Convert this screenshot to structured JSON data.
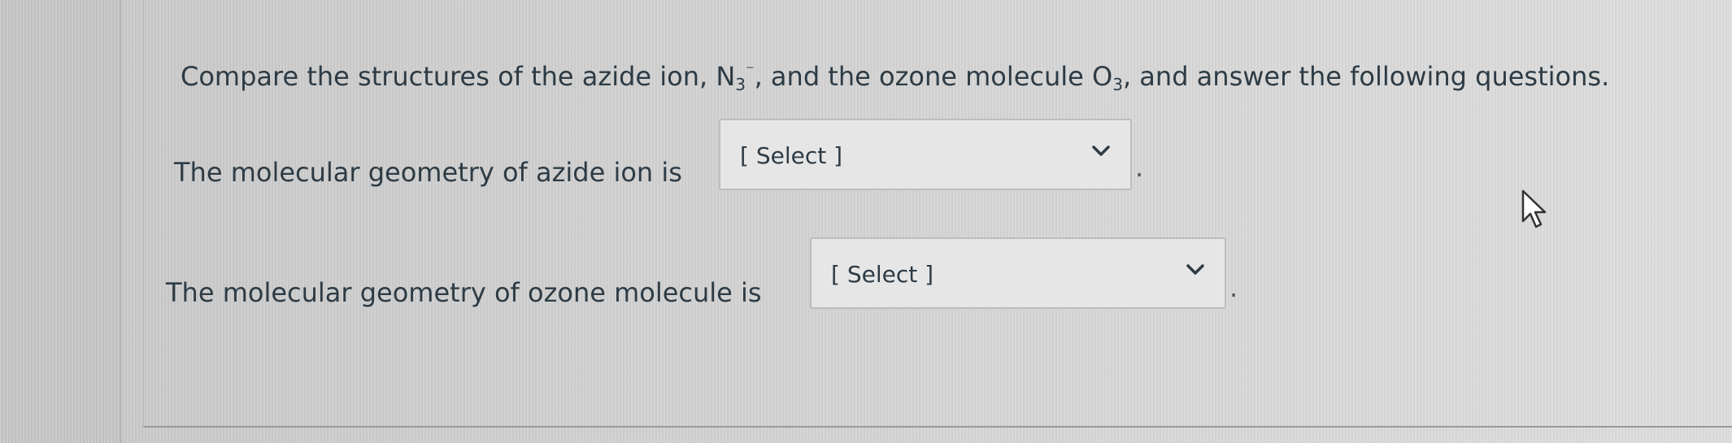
{
  "question": {
    "intro_before_n3": "Compare the structures of the azide ion, N",
    "n3_subscript": "3",
    "n3_superscript": "⁻",
    "intro_middle": ", and the ozone molecule O",
    "o3_subscript": "3",
    "intro_end": ", and answer the following questions."
  },
  "rows": [
    {
      "label": "The molecular geometry of azide ion is",
      "select_value": "[ Select ]",
      "after": "."
    },
    {
      "label": "The molecular geometry of ozone molecule is",
      "select_value": "[ Select ]",
      "after": "."
    }
  ],
  "icons": {
    "dropdown": "chevron-down-icon",
    "pointer": "mouse-cursor-icon"
  },
  "colors": {
    "text": "#2d3b45",
    "background": "#d2d2d2",
    "select_background": "#e6e6e6",
    "select_border": "#bdbdbd"
  }
}
